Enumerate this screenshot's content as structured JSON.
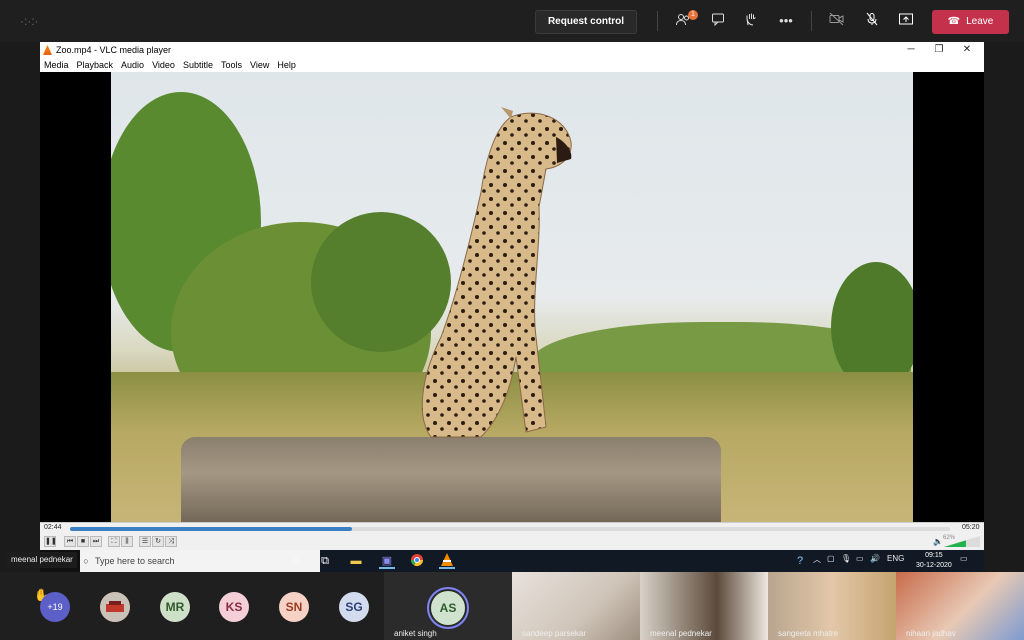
{
  "teams_bar": {
    "request_control_label": "Request control",
    "people_badge": "1",
    "leave_label": "Leave",
    "leave_color": "#c4314b"
  },
  "vlc": {
    "title": "Zoo.mp4 - VLC media player",
    "menu": [
      "Media",
      "Playback",
      "Audio",
      "Video",
      "Subtitle",
      "Tools",
      "View",
      "Help"
    ],
    "elapsed": "02:44",
    "total": "05:20",
    "progress_fraction": 0.32,
    "volume_text": "62%",
    "volume_fraction": 0.62
  },
  "taskbar": {
    "search_placeholder": "Type here to search",
    "lang": "ENG",
    "time": "09:15",
    "date": "30-12-2020"
  },
  "presenter_tag": "meenal pednekar",
  "participants": {
    "overflow": "+19",
    "avatars": [
      {
        "initials": "MR",
        "bg": "#cfe0c8",
        "fg": "#2f5a2a"
      },
      {
        "initials": "KS",
        "bg": "#f4cfd7",
        "fg": "#8a2d43"
      },
      {
        "initials": "SN",
        "bg": "#f6d1c6",
        "fg": "#9a3a20"
      },
      {
        "initials": "SG",
        "bg": "#d3dcef",
        "fg": "#2d3f75"
      }
    ],
    "active": {
      "initials": "AS",
      "name": "aniket singh"
    },
    "video_tiles": [
      {
        "name": "sandeep parsekar"
      },
      {
        "name": "meenal pednekar"
      },
      {
        "name": "sangeeta mhatre"
      },
      {
        "name": "nihaan jadhav"
      }
    ]
  }
}
